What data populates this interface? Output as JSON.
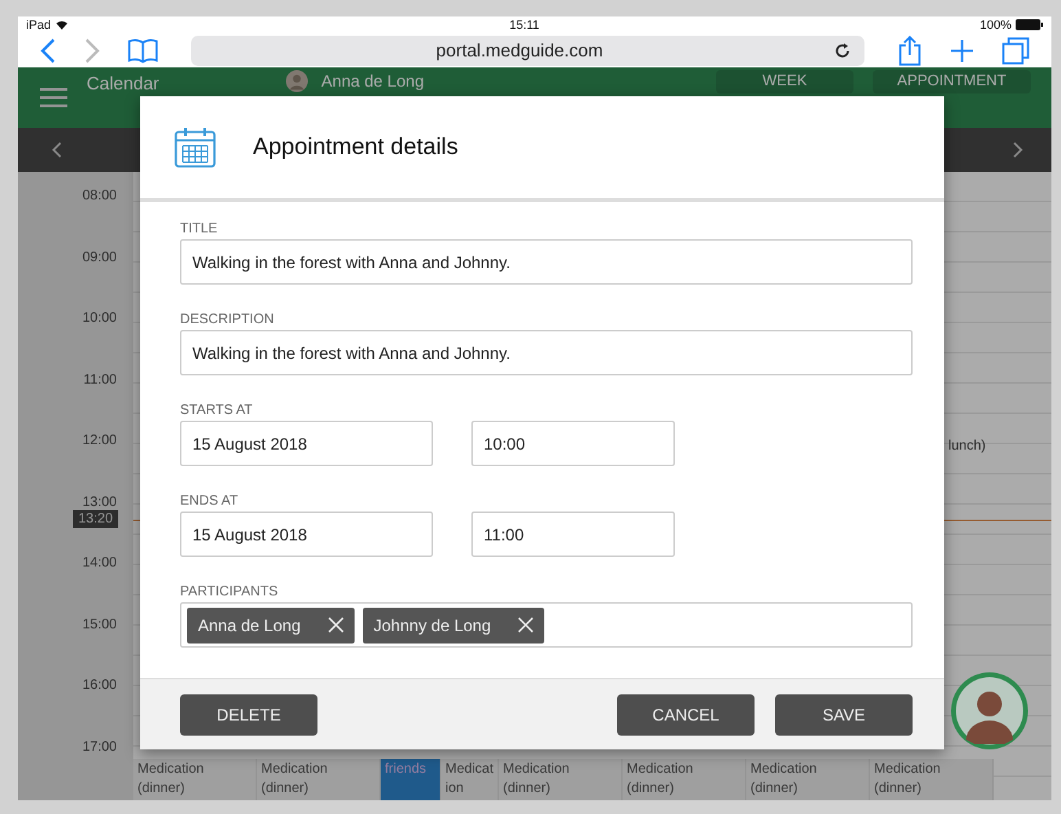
{
  "status_bar": {
    "device": "iPad",
    "time": "15:11",
    "battery": "100%"
  },
  "browser": {
    "url": "portal.medguide.com"
  },
  "app_header": {
    "title": "Calendar",
    "user": "Anna de Long",
    "view_button": "WEEK",
    "add_button": "APPOINTMENT"
  },
  "calendar": {
    "hours": [
      "08:00",
      "09:00",
      "10:00",
      "11:00",
      "12:00",
      "13:00",
      "14:00",
      "15:00",
      "16:00",
      "17:00"
    ],
    "current_time": "13:20",
    "side_event": "lunch)",
    "bottom_events": [
      {
        "kind": "event",
        "line_1": "Medication",
        "line_2": "(dinner)"
      },
      {
        "kind": "event",
        "line_1": "Medication",
        "line_2": "(dinner)"
      },
      {
        "kind": "highlight",
        "line_1": "friends"
      },
      {
        "kind": "narrow",
        "line_1": "Medicat",
        "line_2": "ion"
      },
      {
        "kind": "event",
        "line_1": "Medication",
        "line_2": "(dinner)"
      },
      {
        "kind": "event",
        "line_1": "Medication",
        "line_2": "(dinner)"
      },
      {
        "kind": "event",
        "line_1": "Medication",
        "line_2": "(dinner)"
      },
      {
        "kind": "event",
        "line_1": "Medication",
        "line_2": "(dinner)"
      }
    ]
  },
  "dialog": {
    "title": "Appointment details",
    "title_field": {
      "label": "TITLE",
      "value": "Walking in the forest with Anna and Johnny."
    },
    "description_field": {
      "label": "DESCRIPTION",
      "value": "Walking in the forest with Anna and Johnny."
    },
    "starts_at": {
      "label": "STARTS AT",
      "date": "15 August 2018",
      "time": "10:00"
    },
    "ends_at": {
      "label": "ENDS AT",
      "date": "15 August 2018",
      "time": "11:00"
    },
    "participants": {
      "label": "PARTICIPANTS",
      "chips": [
        "Anna de Long",
        "Johnny de Long"
      ]
    },
    "buttons": {
      "delete": "DELETE",
      "cancel": "CANCEL",
      "save": "SAVE"
    }
  }
}
